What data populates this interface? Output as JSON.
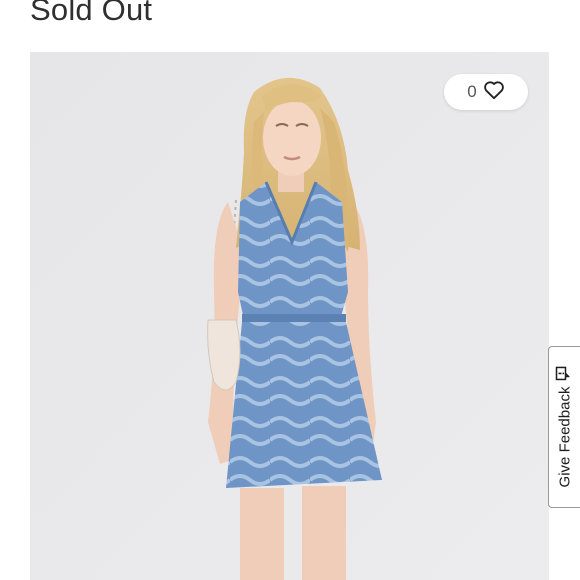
{
  "product": {
    "status": "Sold Out",
    "likes": "0"
  },
  "feedback": {
    "label": "Give Feedback"
  },
  "icons": {
    "like": "heart-outline-icon",
    "feedback": "comment-icon"
  },
  "colors": {
    "dress": "#6f95c6",
    "background": "#e9e9eb"
  }
}
